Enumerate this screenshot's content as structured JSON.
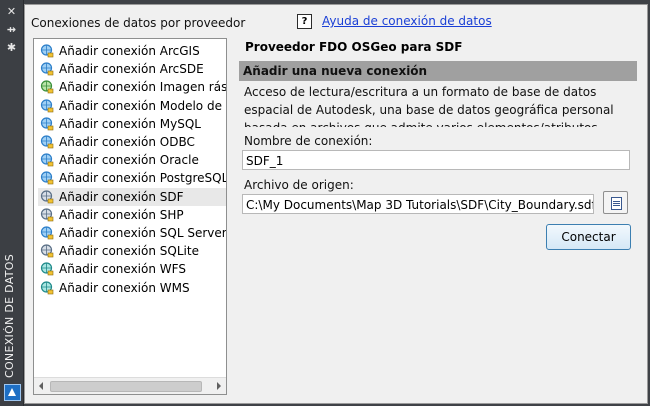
{
  "palette": {
    "title_bar": "#3f4247",
    "section_bar": "#a0a0a0",
    "link": "#1a3fd6"
  },
  "window": {
    "vertical_title": "CONEXIÓN DE DATOS",
    "controls": {
      "close_icon": "✕",
      "pin_icon": "⇸",
      "settings_icon": "✱"
    }
  },
  "left": {
    "header": "Conexiones de datos por proveedor",
    "items": [
      {
        "label": "Añadir conexión ArcGIS",
        "icon": "globe-plug-icon"
      },
      {
        "label": "Añadir conexión ArcSDE",
        "icon": "globe-plug-icon"
      },
      {
        "label": "Añadir conexión Imagen ráster o",
        "icon": "raster-plug-icon"
      },
      {
        "label": "Añadir conexión Modelo de secto",
        "icon": "globe-plug-icon"
      },
      {
        "label": "Añadir conexión MySQL",
        "icon": "globe-plug-icon"
      },
      {
        "label": "Añadir conexión ODBC",
        "icon": "globe-plug-icon"
      },
      {
        "label": "Añadir conexión Oracle",
        "icon": "globe-plug-icon"
      },
      {
        "label": "Añadir conexión PostgreSQL",
        "icon": "globe-plug-icon"
      },
      {
        "label": "Añadir conexión SDF",
        "icon": "file-plug-icon",
        "selected": true
      },
      {
        "label": "Añadir conexión SHP",
        "icon": "file-plug-icon"
      },
      {
        "label": "Añadir conexión SQL Server Spa",
        "icon": "globe-plug-icon"
      },
      {
        "label": "Añadir conexión SQLite",
        "icon": "file-plug-icon"
      },
      {
        "label": "Añadir conexión WFS",
        "icon": "world-plug-icon"
      },
      {
        "label": "Añadir conexión WMS",
        "icon": "world-plug-icon"
      }
    ]
  },
  "right": {
    "help_icon": "?",
    "help_link": "Ayuda de conexión de datos",
    "provider_title": "Proveedor FDO OSGeo para SDF",
    "section_title": "Añadir una nueva conexión",
    "description": "Acceso de lectura/escritura a un formato de base de datos espacial de Autodesk, una base de datos geográfica personal basada en archivos que admite varios elementos/atributos, índices espaciales y bloqueo de archivos.",
    "connection_name_label": "Nombre de conexión:",
    "connection_name_value": "SDF_1",
    "source_file_label": "Archivo de origen:",
    "source_file_value": "C:\\My Documents\\Map 3D Tutorials\\SDF\\City_Boundary.sdf",
    "connect_button": "Conectar"
  }
}
